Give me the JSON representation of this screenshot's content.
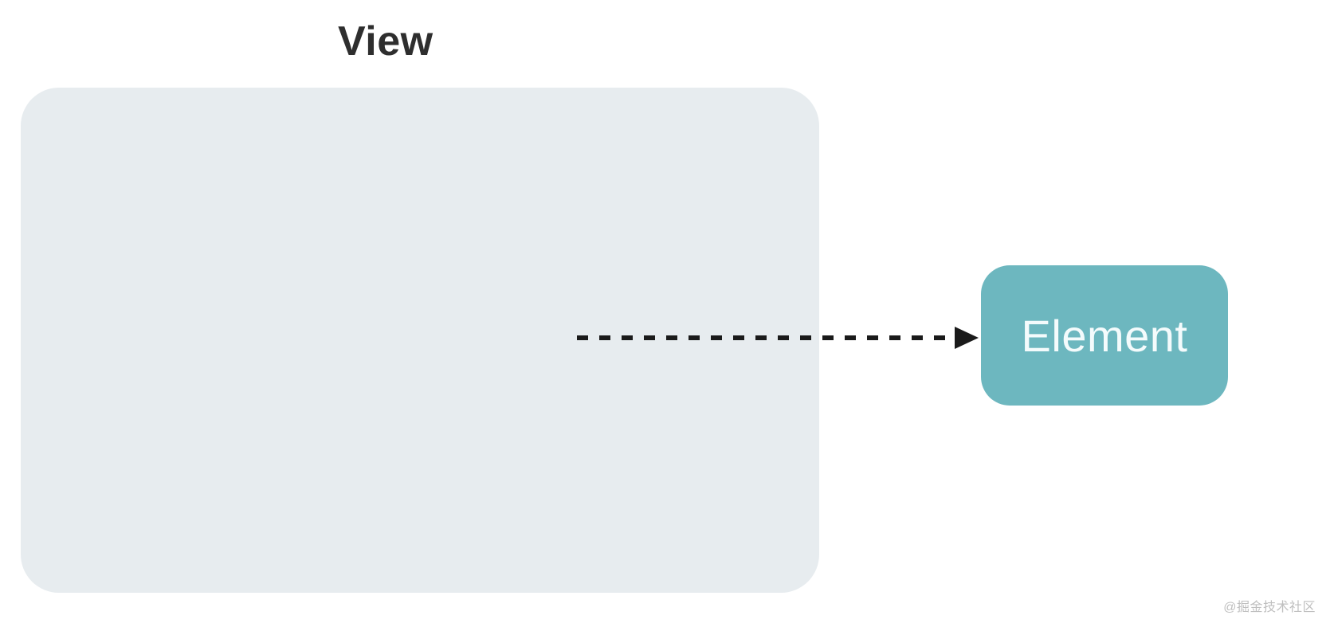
{
  "diagram": {
    "view_title": "View",
    "element_label": "Element",
    "arrow": {
      "style": "dashed",
      "direction": "left-to-right",
      "from": "View",
      "to": "Element"
    }
  },
  "watermark": "@掘金技术社区",
  "colors": {
    "view_box_bg": "#e7ecef",
    "element_box_bg": "#6db7bf",
    "element_text": "#f4fbfc",
    "title_text": "#2e2e2e",
    "arrow": "#1a1a1a"
  }
}
